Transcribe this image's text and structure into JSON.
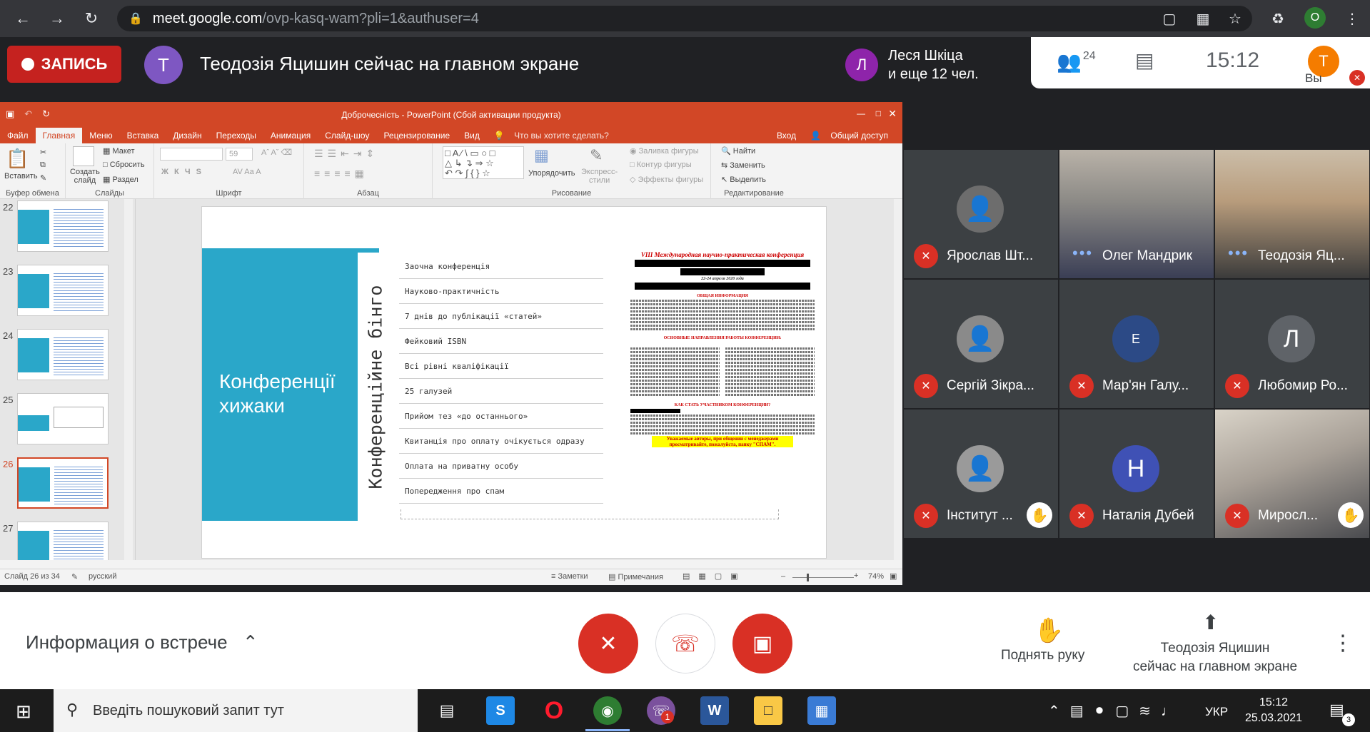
{
  "browser": {
    "url_host": "meet.google.com",
    "url_path": "/ovp-kasq-wam?pli=1&authuser=4",
    "profile_initial": "O"
  },
  "meet": {
    "record_label": "ЗАПИСЬ",
    "presenter_initial": "Т",
    "presenting_text": "Теодозія Яцишин сейчас на главном экране",
    "speaker_initial": "Л",
    "speaker_line1": "Леся Шкіца",
    "speaker_line2": "и еще 12 чел.",
    "people_count": "24",
    "clock": "15:12",
    "you_initial": "Т",
    "you_label": "Вы",
    "meeting_info": "Информация о встрече",
    "raise_hand": "Поднять руку",
    "present_line1": "Теодозія Яцишин",
    "present_line2": "сейчас на главном экране"
  },
  "ppt": {
    "window_title": "Доброчесність - PowerPoint (Сбой активации продукта)",
    "tabs": [
      "Файл",
      "Главная",
      "Меню",
      "Вставка",
      "Дизайн",
      "Переходы",
      "Анимация",
      "Слайд-шоу",
      "Рецензирование",
      "Вид"
    ],
    "tell_me": "Что вы хотите сделать?",
    "signin": "Вход",
    "share": "Общий доступ",
    "ribbon": {
      "paste": "Вставить",
      "clipboard": "Буфер обмена",
      "new_slide_1": "Создать",
      "new_slide_2": "слайд",
      "layout": "Макет",
      "reset": "Сбросить",
      "section": "Раздел",
      "slides": "Слайды",
      "font_size": "59",
      "font": "Шрифт",
      "paragraph": "Абзац",
      "arrange": "Упорядочить",
      "express_1": "Экспресс-",
      "express_2": "стили",
      "shape_fill": "Заливка фигуры",
      "shape_outline": "Контур фигуры",
      "shape_effects": "Эффекты фигуры",
      "drawing": "Рисование",
      "find": "Найти",
      "replace": "Заменить",
      "select": "Выделить",
      "editing": "Редактирование"
    },
    "thumb_numbers": [
      "22",
      "23",
      "24",
      "25",
      "26",
      "27"
    ],
    "slide": {
      "title": "Конференції хижаки",
      "vertical": "Конференційне бінго",
      "items": [
        "Заочна конференція",
        "Науково-практичність",
        "7 днів до публікації «статей»",
        "Фейковий ISBN",
        "Всі рівні кваліфікації",
        "25 галузей",
        "Прийом тез «до останнього»",
        "Квитанція про оплату очікується одразу",
        "Оплата на приватну особу",
        "Попередження про спам"
      ],
      "ann_header": "VIII Международная научно-практическая конференция",
      "ann_dates": "22-24 апреля 2020 года",
      "ann_info_title": "ОБЩАЯ ИНФОРМАЦИЯ",
      "ann_dir_title": "ОСНОВНЫЕ НАПРАВЛЕНИЯ РАБОТЫ КОНФЕРЕНЦИИ:",
      "ann_join_title": "КАК СТАТЬ УЧАСТНИКОМ КОНФЕРЕНЦИИ?",
      "ann_warning": "Уважаемые авторы, при общении с менеджерами просматривайте, пожалуйста, папку \"СПАМ\"."
    },
    "status": {
      "slide_of": "Слайд 26 из 34",
      "lang": "русский",
      "notes": "Заметки",
      "comments": "Примечания",
      "zoom": "74%"
    }
  },
  "participants": [
    {
      "name": "Ярослав Шт...",
      "muted": true,
      "type": "photo"
    },
    {
      "name": "Олег Мандрик",
      "muted": false,
      "type": "video"
    },
    {
      "name": "Теодозія Яц...",
      "muted": false,
      "type": "video"
    },
    {
      "name": "Сергій Зікра...",
      "muted": true,
      "type": "photo"
    },
    {
      "name": "Мар'ян Галу...",
      "muted": true,
      "type": "logo"
    },
    {
      "name": "Любомир Ро...",
      "muted": true,
      "type": "initial",
      "initial": "Л",
      "color": "#5f6368"
    },
    {
      "name": "Інститут ...",
      "muted": true,
      "type": "photo",
      "hand": true
    },
    {
      "name": "Наталія Дубей",
      "muted": true,
      "type": "initial",
      "initial": "Н",
      "color": "#3f51b5"
    },
    {
      "name": "Миросл...",
      "muted": true,
      "type": "video",
      "hand": true
    }
  ],
  "taskbar": {
    "search_placeholder": "Введіть пошуковий запит тут",
    "lang": "УКР",
    "time": "15:12",
    "date": "25.03.2021",
    "viber_badge": "1",
    "notif_count": "3"
  }
}
